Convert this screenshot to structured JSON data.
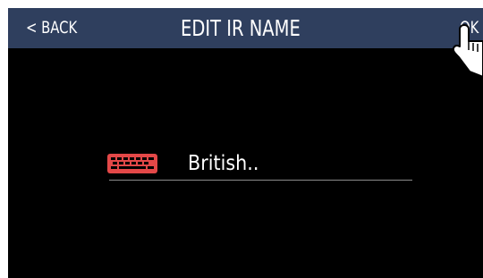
{
  "header": {
    "back_label": "< BACK",
    "title": "EDIT IR NAME",
    "ok_label": "OK"
  },
  "name_field": {
    "value": "British..",
    "icon": "keyboard-icon"
  },
  "overlay": {
    "icon": "pointing-hand-icon"
  },
  "colors": {
    "header_bg": "#2f3f5e",
    "screen_bg": "#000000",
    "keyboard_icon": "#e34848",
    "text": "#ffffff",
    "underline": "#8a8a8a"
  }
}
